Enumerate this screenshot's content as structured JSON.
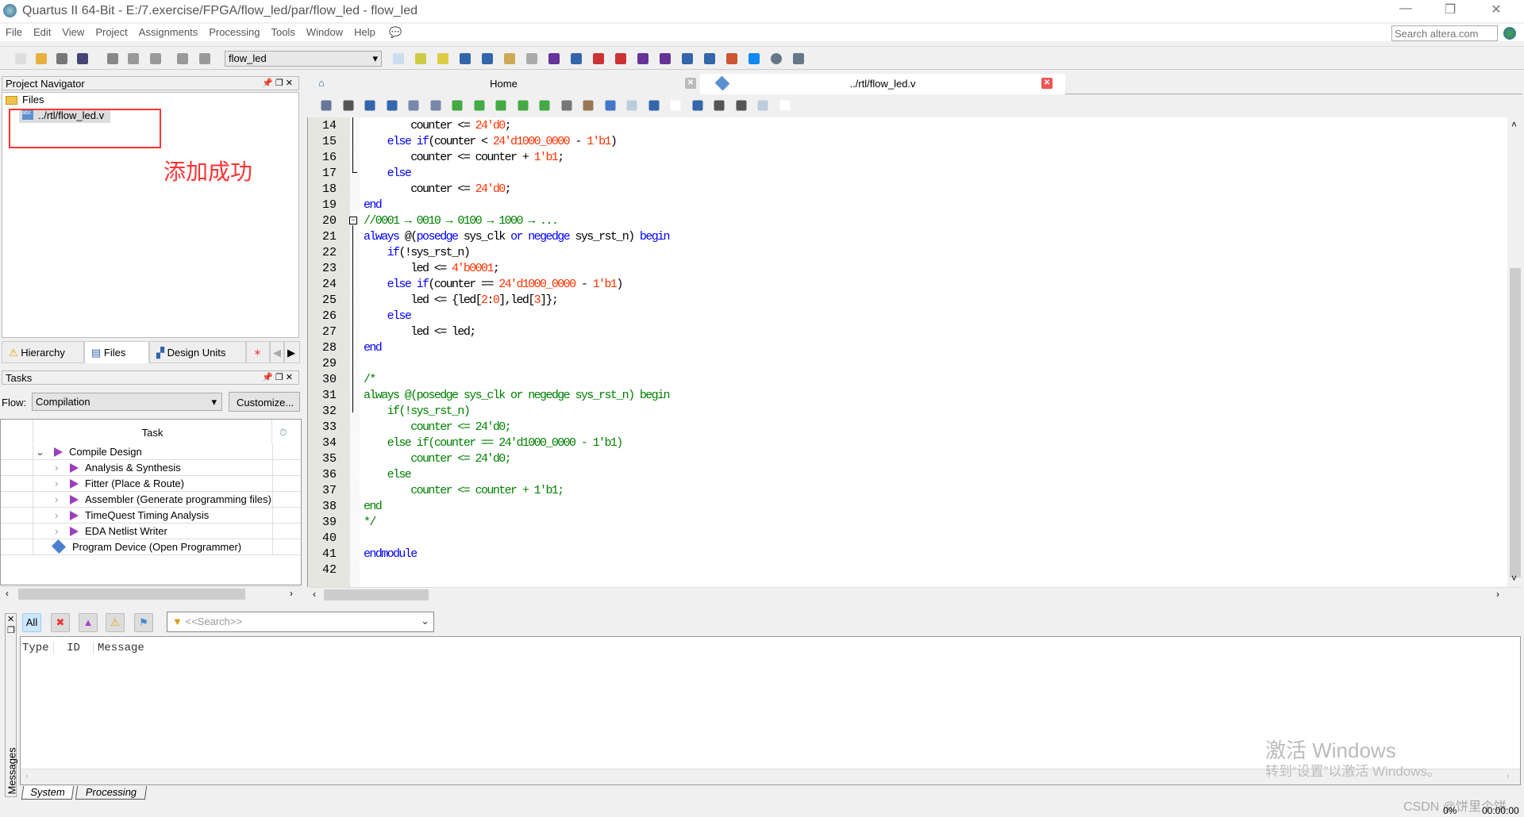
{
  "window": {
    "title": "Quartus II 64-Bit - E:/7.exercise/FPGA/flow_led/par/flow_led - flow_led",
    "minimize": "—",
    "restore": "❐",
    "close": "✕"
  },
  "menu": [
    "File",
    "Edit",
    "View",
    "Project",
    "Assignments",
    "Processing",
    "Tools",
    "Window",
    "Help"
  ],
  "search_altera": {
    "placeholder": "Search altera.com"
  },
  "toolbar": {
    "project_combo": "flow_led"
  },
  "project_navigator": {
    "title": "Project Navigator",
    "folder": "Files",
    "file": "../rtl/flow_led.v",
    "annotation": "添加成功",
    "tabs": [
      "Hierarchy",
      "Files",
      "Design Units"
    ]
  },
  "tasks": {
    "title": "Tasks",
    "flow_label": "Flow:",
    "flow_value": "Compilation",
    "customize": "Customize...",
    "column": "Task",
    "items": [
      {
        "label": "Compile Design",
        "level": 0
      },
      {
        "label": "Analysis & Synthesis",
        "level": 1
      },
      {
        "label": "Fitter (Place & Route)",
        "level": 1
      },
      {
        "label": "Assembler (Generate programming files)",
        "level": 1
      },
      {
        "label": "TimeQuest Timing Analysis",
        "level": 1
      },
      {
        "label": "EDA Netlist Writer",
        "level": 1
      },
      {
        "label": "Program Device (Open Programmer)",
        "level": 2
      }
    ]
  },
  "editor": {
    "tabs": [
      {
        "label": "Home"
      },
      {
        "label": "../rtl/flow_led.v"
      }
    ],
    "lines": [
      {
        "n": "14",
        "s": [
          [
            "        counter <= ",
            ""
          ],
          [
            "24'd0",
            "n"
          ],
          [
            ";",
            ""
          ]
        ]
      },
      {
        "n": "15",
        "s": [
          [
            "    ",
            ""
          ],
          [
            "else if",
            "k"
          ],
          [
            "(counter < ",
            ""
          ],
          [
            "24'd1000_0000",
            "n"
          ],
          [
            " - ",
            ""
          ],
          [
            "1'b1",
            "n"
          ],
          [
            ")",
            ""
          ]
        ]
      },
      {
        "n": "16",
        "s": [
          [
            "        counter <= counter + ",
            ""
          ],
          [
            "1'b1",
            "n"
          ],
          [
            ";",
            ""
          ]
        ]
      },
      {
        "n": "17",
        "s": [
          [
            "    ",
            ""
          ],
          [
            "else",
            "k"
          ]
        ]
      },
      {
        "n": "18",
        "s": [
          [
            "        counter <= ",
            ""
          ],
          [
            "24'd0",
            "n"
          ],
          [
            ";",
            ""
          ]
        ]
      },
      {
        "n": "19",
        "s": [
          [
            "end",
            "k"
          ]
        ]
      },
      {
        "n": "20",
        "s": [
          [
            "//0001 → 0010 → 0100 → 1000 → ...",
            "c"
          ]
        ]
      },
      {
        "n": "21",
        "s": [
          [
            "always",
            "k"
          ],
          [
            " @(",
            ""
          ],
          [
            "posedge",
            "k"
          ],
          [
            " sys_clk ",
            ""
          ],
          [
            "or negedge",
            "k"
          ],
          [
            " sys_rst_n) ",
            ""
          ],
          [
            "begin",
            "k"
          ]
        ]
      },
      {
        "n": "22",
        "s": [
          [
            "    ",
            ""
          ],
          [
            "if",
            "k"
          ],
          [
            "(!sys_rst_n)",
            ""
          ]
        ]
      },
      {
        "n": "23",
        "s": [
          [
            "        led <= ",
            ""
          ],
          [
            "4'b0001",
            "n"
          ],
          [
            ";",
            ""
          ]
        ]
      },
      {
        "n": "24",
        "s": [
          [
            "    ",
            ""
          ],
          [
            "else if",
            "k"
          ],
          [
            "(counter == ",
            ""
          ],
          [
            "24'd1000_0000",
            "n"
          ],
          [
            " - ",
            ""
          ],
          [
            "1'b1",
            "n"
          ],
          [
            ")",
            ""
          ]
        ]
      },
      {
        "n": "25",
        "s": [
          [
            "        led <= {led[",
            ""
          ],
          [
            "2",
            "n"
          ],
          [
            ":",
            ""
          ],
          [
            "0",
            "n"
          ],
          [
            "],led[",
            ""
          ],
          [
            "3",
            "n"
          ],
          [
            "]};",
            ""
          ]
        ]
      },
      {
        "n": "26",
        "s": [
          [
            "    ",
            ""
          ],
          [
            "else",
            "k"
          ]
        ]
      },
      {
        "n": "27",
        "s": [
          [
            "        led <= led;",
            ""
          ]
        ]
      },
      {
        "n": "28",
        "s": [
          [
            "end",
            "k"
          ]
        ]
      },
      {
        "n": "29",
        "s": []
      },
      {
        "n": "30",
        "s": [
          [
            "/*",
            "c"
          ]
        ]
      },
      {
        "n": "31",
        "s": [
          [
            "always @(posedge sys_clk or negedge sys_rst_n) begin",
            "c"
          ]
        ]
      },
      {
        "n": "32",
        "s": [
          [
            "    if(!sys_rst_n)",
            "c"
          ]
        ]
      },
      {
        "n": "33",
        "s": [
          [
            "        counter <= 24'd0;",
            "c"
          ]
        ]
      },
      {
        "n": "34",
        "s": [
          [
            "    else if(counter == 24'd1000_0000 - 1'b1)",
            "c"
          ]
        ]
      },
      {
        "n": "35",
        "s": [
          [
            "        counter <= 24'd0;",
            "c"
          ]
        ]
      },
      {
        "n": "36",
        "s": [
          [
            "    else",
            "c"
          ]
        ]
      },
      {
        "n": "37",
        "s": [
          [
            "        counter <= counter + 1'b1;",
            "c"
          ]
        ]
      },
      {
        "n": "38",
        "s": [
          [
            "end",
            "c"
          ]
        ]
      },
      {
        "n": "39",
        "s": [
          [
            "*/",
            "c"
          ]
        ]
      },
      {
        "n": "40",
        "s": []
      },
      {
        "n": "41",
        "s": [
          [
            "endmodule",
            "k"
          ]
        ]
      },
      {
        "n": "42",
        "s": []
      }
    ]
  },
  "messages": {
    "panel_label": "Messages",
    "all": "All",
    "search_placeholder": "<<Search>>",
    "columns": [
      "Type",
      "ID",
      "Message"
    ],
    "tabs": [
      "System",
      "Processing"
    ]
  },
  "status": {
    "progress": "0%",
    "time": "00:00:00"
  },
  "watermark": {
    "line1": "激活 Windows",
    "line2": "转到“设置”以激活 Windows。",
    "csdn": "CSDN @饼里个饼"
  },
  "colors": {
    "keyword": "#0000ff",
    "number": "#ff3300",
    "comment": "#008000",
    "annotation": "#ff3333"
  }
}
